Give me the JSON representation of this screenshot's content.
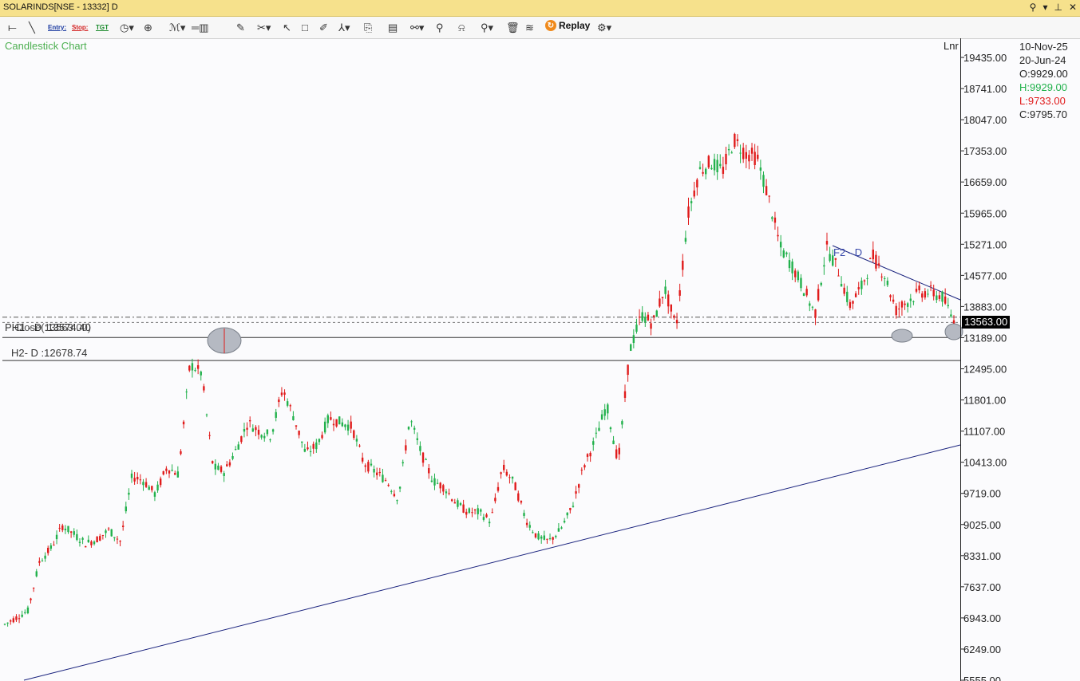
{
  "window": {
    "title": "SOLARINDS[NSE - 13332] D"
  },
  "toolbar": {
    "entry_label": "Entry:",
    "stop_label": "Stop:",
    "tgt_label": "TGT",
    "replay_label": "Replay"
  },
  "chart": {
    "type_label": "Candlestick Chart",
    "scale_label": "Lnr",
    "current_price": "13563.00",
    "h1_label": "PH1 - D :13574.40",
    "close_label": "Close(13563.00)",
    "h2_label": "H2- D :12678.74",
    "f2_label": "F2 - D"
  },
  "ohlc": {
    "date1": "10-Nov-25",
    "date2": "20-Jun-24",
    "open": "O:9929.00",
    "high": "H:9929.00",
    "low": "L:9733.00",
    "close": "C:9795.70"
  },
  "colors": {
    "up": "#22b14c",
    "down": "#e01b1b",
    "trend": "#1a237e",
    "bg": "#fbfbfd"
  },
  "chart_data": {
    "type": "candlestick",
    "ylim": [
      5555,
      19800
    ],
    "y_ticks": [
      "19435.00",
      "18741.00",
      "18047.00",
      "17353.00",
      "16659.00",
      "15965.00",
      "15271.00",
      "14577.00",
      "13883.00",
      "13189.00",
      "12495.00",
      "11801.00",
      "11107.00",
      "10413.00",
      "9719.00",
      "9025.00",
      "8331.00",
      "7637.00",
      "6943.00",
      "6249.00",
      "5555.00"
    ],
    "series": [
      {
        "values": [
          6800,
          6950,
          7100,
          8200,
          8500,
          9000,
          8800,
          8600,
          8700,
          8900,
          8650,
          10100,
          10000,
          9700,
          10300,
          10150,
          12600,
          12400,
          10300,
          10200,
          10700,
          11300,
          11100,
          11000,
          12050,
          11400,
          10600,
          10800,
          11400,
          11300,
          11200,
          10400,
          10200,
          10000,
          9600,
          11400,
          10600,
          10000,
          9850,
          9500,
          9300,
          9300,
          9100,
          10300,
          9950,
          9150,
          8750,
          8650,
          8900,
          9400,
          10300,
          10900,
          11700,
          10400,
          12900,
          13700,
          13500,
          14300,
          13400,
          15900,
          16900,
          17100,
          16900,
          17600,
          17300,
          17200,
          16300,
          15200,
          14800,
          14300,
          13700,
          15200,
          14700,
          13900,
          14300,
          15000,
          14600,
          13800,
          14000,
          14200,
          14200,
          14100,
          13563
        ]
      }
    ],
    "annotations": [
      "PH1 - D :13574.40",
      "Close(13563.00)",
      "H2- D :12678.74",
      "F2 - D"
    ]
  }
}
